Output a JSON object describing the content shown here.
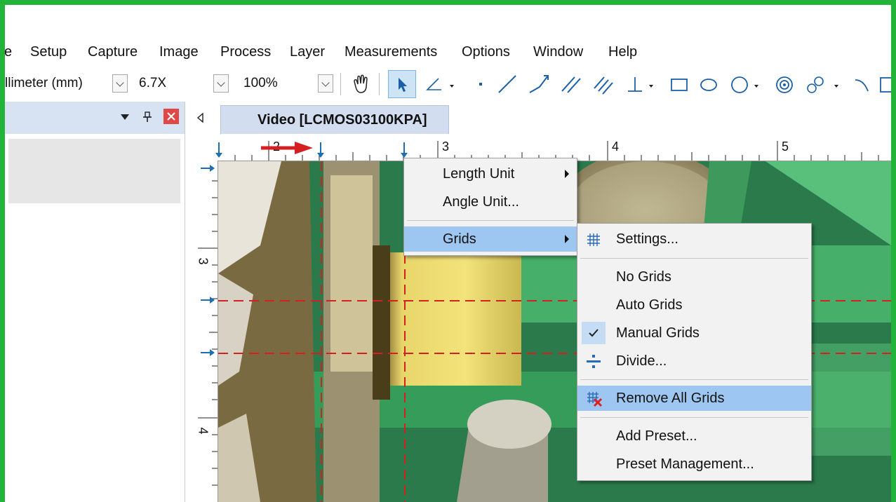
{
  "menubar": {
    "items": [
      {
        "label": "e"
      },
      {
        "label": "Setup"
      },
      {
        "label": "Capture"
      },
      {
        "label": "Image"
      },
      {
        "label": "Process"
      },
      {
        "label": "Layer"
      },
      {
        "label": "Measurements"
      },
      {
        "label": "Options"
      },
      {
        "label": "Window"
      },
      {
        "label": "Help"
      }
    ]
  },
  "toolbar": {
    "unit_value": "llimeter (mm)",
    "magnification_value": "6.7X",
    "zoom_value": "100%"
  },
  "document": {
    "tab_label": "Video [LCMOS03100KPA]"
  },
  "ruler": {
    "h_labels": [
      "2",
      "3",
      "4",
      "5"
    ],
    "v_labels": [
      "3",
      "4"
    ]
  },
  "context_menu": {
    "items": [
      {
        "label": "Length Unit"
      },
      {
        "label": "Angle Unit..."
      },
      {
        "label": "Grids"
      }
    ]
  },
  "grids_submenu": {
    "items": [
      {
        "label": "Settings..."
      },
      {
        "label": "No Grids"
      },
      {
        "label": "Auto Grids"
      },
      {
        "label": "Manual Grids"
      },
      {
        "label": "Divide..."
      },
      {
        "label": "Remove All Grids"
      },
      {
        "label": "Add Preset..."
      },
      {
        "label": "Preset Management..."
      }
    ],
    "checked_item": "Manual Grids",
    "highlighted_item": "Remove All Grids"
  },
  "colors": {
    "frame": "#22b33a",
    "grid_line": "#d42020",
    "highlight": "#9dc7f0",
    "panel_header": "#d7e3f3",
    "annotation_arrow": "#d42020"
  }
}
